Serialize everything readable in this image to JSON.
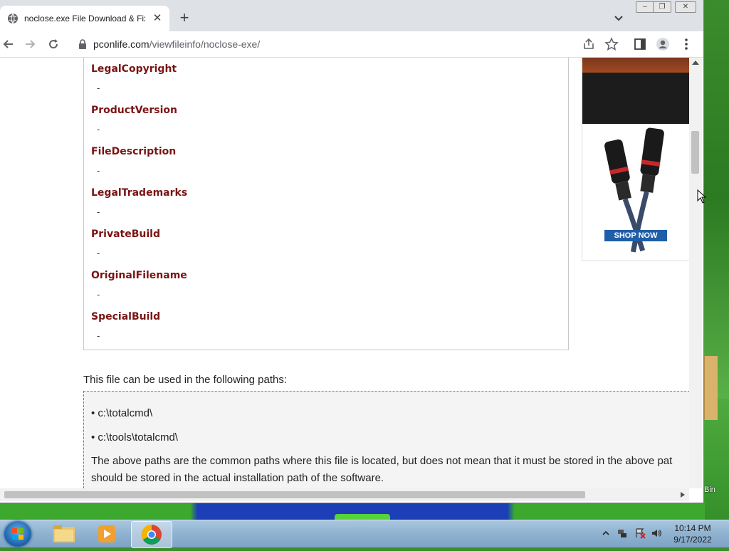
{
  "browser": {
    "tab_title": "noclose.exe File Download & Fix",
    "url_domain": "pconlife.com",
    "url_path": "/viewfileinfo/noclose-exe/"
  },
  "file_properties": [
    {
      "key": "LegalCopyright",
      "value": "-"
    },
    {
      "key": "ProductVersion",
      "value": "-"
    },
    {
      "key": "FileDescription",
      "value": "-"
    },
    {
      "key": "LegalTrademarks",
      "value": "-"
    },
    {
      "key": "PrivateBuild",
      "value": "-"
    },
    {
      "key": "OriginalFilename",
      "value": "-"
    },
    {
      "key": "SpecialBuild",
      "value": "-"
    }
  ],
  "ad": {
    "button": "SHOP NOW"
  },
  "paths_section": {
    "intro": "This file can be used in the following paths:",
    "paths": [
      "• c:\\totalcmd\\",
      "• c:\\tools\\totalcmd\\"
    ],
    "note_line1": "The above paths are the common paths where this file is located, but does not mean that it must be stored in the above pat",
    "note_line2": "should be stored in the actual installation path of the software."
  },
  "desktop": {
    "recycle_bin_label": "Bin"
  },
  "taskbar": {
    "time": "10:14 PM",
    "date": "9/17/2022",
    "apps": [
      "windows-explorer",
      "media-player",
      "chrome"
    ]
  }
}
